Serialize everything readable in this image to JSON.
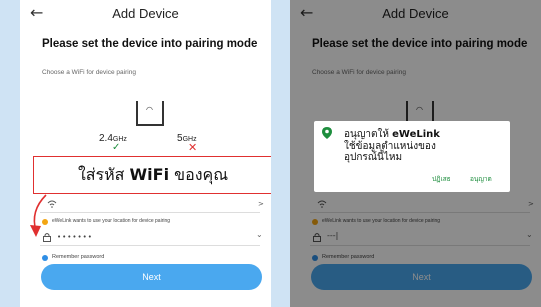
{
  "left": {
    "title": "Add Device",
    "heading": "Please set the device into pairing mode",
    "subheading": "Choose a WiFi for device pairing",
    "freq_24": "2.4",
    "freq_24_unit": "GHz",
    "freq_5": "5",
    "freq_5_unit": "GHz",
    "overlay_text_1": "ใส่รหัส",
    "overlay_text_2": "WiFi",
    "overlay_text_3": "ของคุณ",
    "wifi_chevron": ">",
    "location_note": "eWeLink wants to use your location for device pairing",
    "password_mask": "•••••••",
    "remember": "Remember password",
    "next_button": "Next"
  },
  "right": {
    "title": "Add Device",
    "heading": "Please set the device into pairing mode",
    "subheading": "Choose a WiFi for device pairing",
    "dialog_line1a": "อนุญาตให้ ",
    "dialog_line1b": "eWeLink",
    "dialog_line2": "ใช้ข้อมูลตำแหน่งของ",
    "dialog_line3": "อุปกรณ์นี้ไหม",
    "dialog_deny": "ปฏิเสธ",
    "dialog_allow": "อนุญาต",
    "wifi_chevron": ">",
    "location_note": "eWeLink wants to use your location for device pairing",
    "password_typed": "---|",
    "remember": "Remember password",
    "next_button": "Next"
  },
  "icons": {
    "back": "←",
    "check": "✓",
    "cross": "✕",
    "wifi": "⌔",
    "lock": "🔒",
    "chevron_down": "⌄",
    "pin": "📍"
  },
  "colors": {
    "accent": "#4aa8ef",
    "ok": "#1e8e3e",
    "error": "#e03030",
    "warning": "#f3a512",
    "background": "#cfe3f4"
  }
}
